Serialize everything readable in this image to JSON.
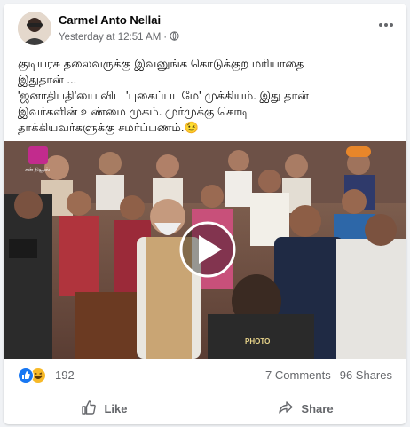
{
  "post": {
    "author": "Carmel Anto Nellai",
    "timestamp": "Yesterday at 12:51 AM",
    "separator": "·",
    "privacy_icon": "globe-icon",
    "more_icon": "ellipsis-icon",
    "text_lines": [
      "குடியரசு தலைவருக்கு இவனுங்க கொடுக்குற மரியாதை",
      "இதுதான் ...",
      " 'ஜனாதிபதி'யை விட 'புகைப்படமே' முக்கியம். இது தான்",
      "இவர்களின் உண்மை முகம். முர்முக்கு கொடி",
      "தாக்கியவர்களுக்கு சமர்ப்பணம்.😉"
    ]
  },
  "media": {
    "type": "video",
    "play_icon": "play-icon",
    "channel_logo_text": "சன் நியூஸ்",
    "press_badge_text": "PHOTO"
  },
  "stats": {
    "reactions": [
      "like-icon",
      "haha-icon"
    ],
    "reaction_count": "192",
    "comments": "7 Comments",
    "shares": "96 Shares"
  },
  "actions": {
    "like_label": "Like",
    "share_label": "Share"
  },
  "colors": {
    "background": "#f0f2f5",
    "like_blue": "#1877f2",
    "haha_yellow": "#f7b928",
    "muted_text": "#65676b"
  }
}
